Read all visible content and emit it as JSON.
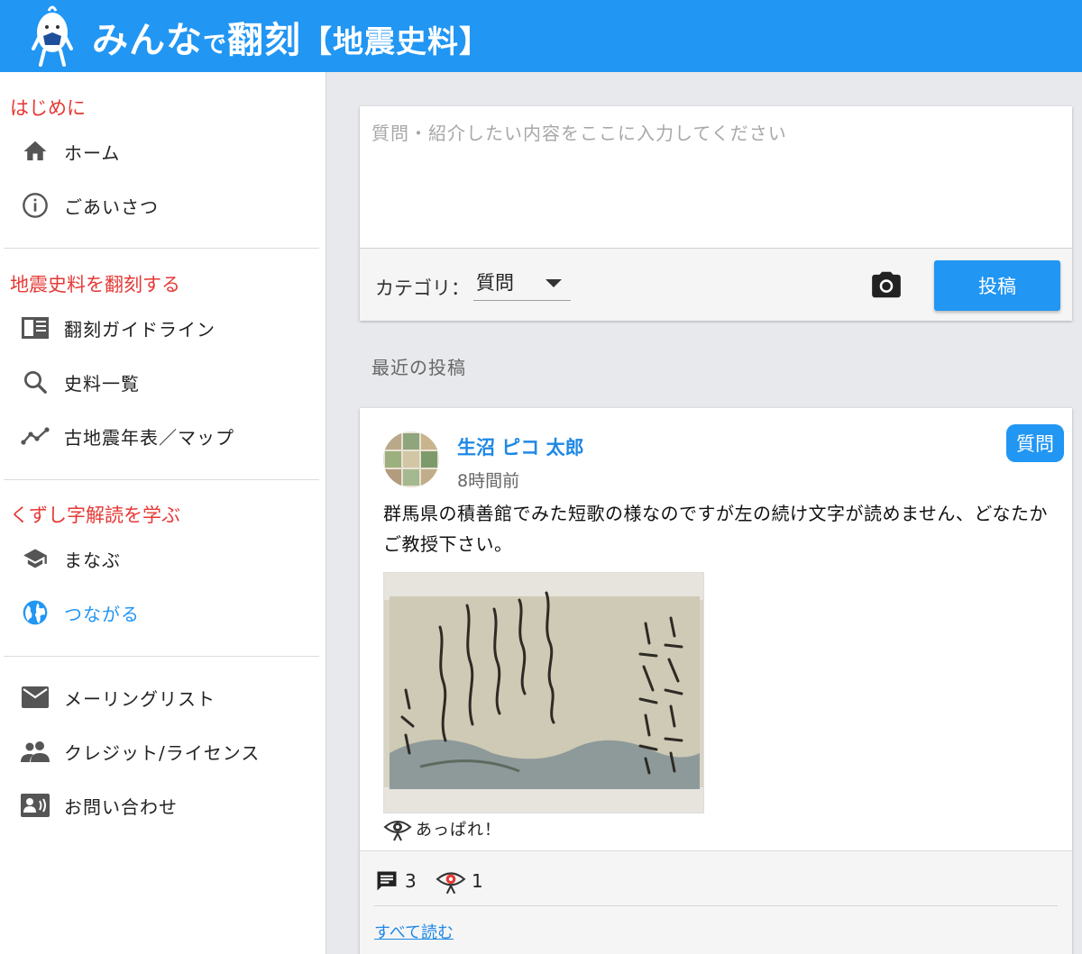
{
  "header": {
    "title_main_1": "みんな",
    "title_small": "で",
    "title_main_2": "翻刻",
    "title_sub": "【地震史料】"
  },
  "sidebar": {
    "sections": [
      {
        "title": "はじめに",
        "items": [
          {
            "label": "ホーム",
            "icon": "home-icon"
          },
          {
            "label": "ごあいさつ",
            "icon": "info-icon"
          }
        ]
      },
      {
        "title": "地震史料を翻刻する",
        "items": [
          {
            "label": "翻刻ガイドライン",
            "icon": "book-icon"
          },
          {
            "label": "史料一覧",
            "icon": "search-icon"
          },
          {
            "label": "古地震年表／マップ",
            "icon": "timeline-icon"
          }
        ]
      },
      {
        "title": "くずし字解読を学ぶ",
        "items": [
          {
            "label": "まなぶ",
            "icon": "school-icon"
          },
          {
            "label": "つながる",
            "icon": "globe-icon",
            "active": true
          }
        ]
      },
      {
        "title": "",
        "items": [
          {
            "label": "メーリングリスト",
            "icon": "mail-icon"
          },
          {
            "label": "クレジット/ライセンス",
            "icon": "people-icon"
          },
          {
            "label": "お問い合わせ",
            "icon": "contact-icon"
          }
        ]
      }
    ]
  },
  "composer": {
    "placeholder": "質問・紹介したい内容をここに入力してください",
    "category_label": "カテゴリ：",
    "category_value": "質問",
    "post_label": "投稿"
  },
  "recent_title": "最近の投稿",
  "post": {
    "author": "生沼 ピコ 太郎",
    "time": "8時間前",
    "badge": "質問",
    "body": "群馬県の積善館でみた短歌の様なのですが左の続け文字が読めません、どなたかご教授下さい。",
    "appare_label": "あっぱれ！",
    "comment_count": "3",
    "appare_count": "1",
    "read_all": "すべて読む"
  },
  "colors": {
    "header": "#2196f3",
    "section_title": "#e53935",
    "link": "#1e88e5"
  }
}
